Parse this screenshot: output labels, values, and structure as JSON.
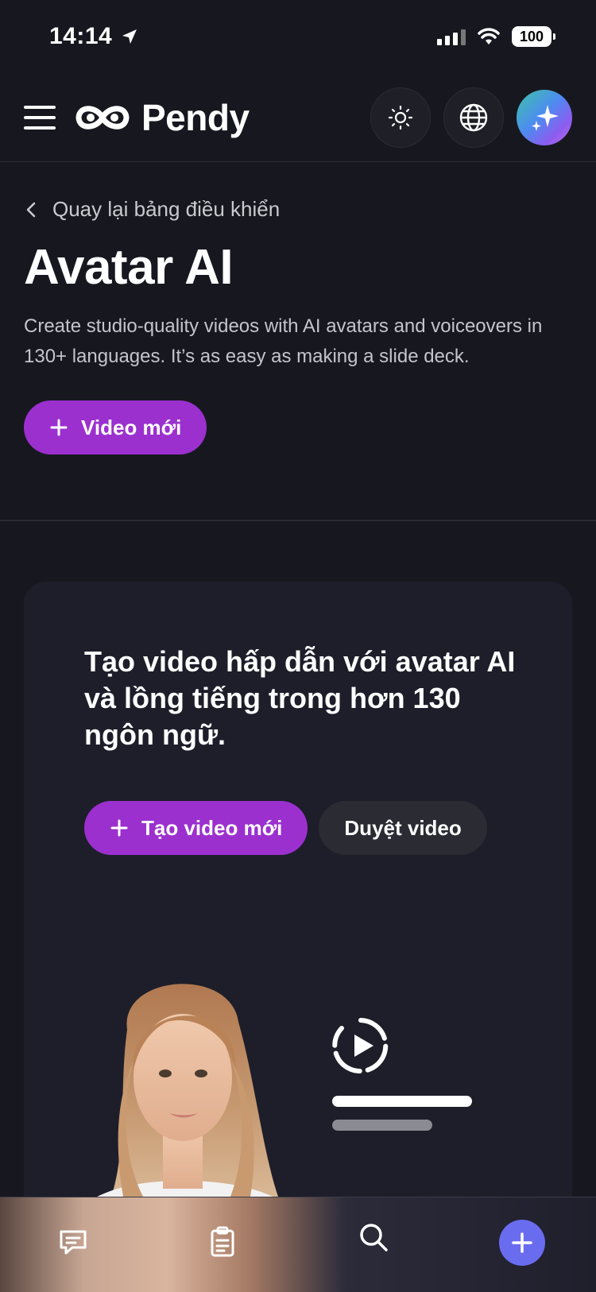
{
  "status_bar": {
    "time": "14:14",
    "battery": "100"
  },
  "header": {
    "logo_text": "Pendy",
    "icons": [
      "menu-icon",
      "logo-icon",
      "sun-icon",
      "globe-icon",
      "sparkle-icon"
    ]
  },
  "hero": {
    "back_label": "Quay lại bảng điều khiển",
    "title": "Avatar AI",
    "description": "Create studio-quality videos with AI avatars and voiceovers in 130+ languages. It’s as easy as making a slide deck.",
    "new_video_label": "Video mới"
  },
  "card": {
    "title": "Tạo video hấp dẫn với avatar AI và lồng tiếng trong hơn 130 ngôn ngữ.",
    "create_label": "Tạo video mới",
    "browse_label": "Duyệt video"
  },
  "bottom_nav": {
    "items": [
      "chat-icon",
      "clipboard-icon",
      "search-icon",
      "plus-icon"
    ]
  },
  "colors": {
    "background": "#17181f",
    "accent": "#9b30cf",
    "fab": "#6a6cf0",
    "card": "#1d1e2a"
  }
}
